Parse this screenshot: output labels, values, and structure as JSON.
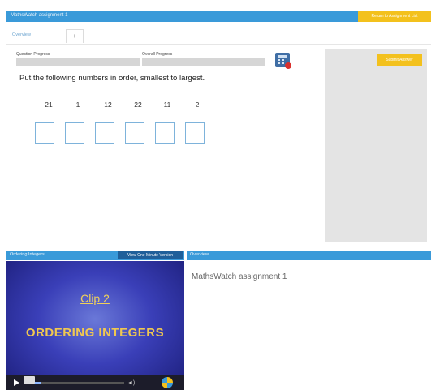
{
  "window": {
    "title": "MathsWatch assignment 1",
    "return_button": "Return to Assignment List"
  },
  "tabs": {
    "overview_label": "Overview",
    "add_label": "+"
  },
  "progress": {
    "question_label": "Question Progress",
    "question_value": 0,
    "overall_label": "Overall Progress",
    "overall_value": 0
  },
  "calculator": {
    "icon": "calculator-icon"
  },
  "question": {
    "prompt": "Put the following numbers in order, smallest to largest.",
    "numbers": [
      "21",
      "1",
      "12",
      "22",
      "11",
      "2"
    ],
    "answer_boxes": [
      "",
      "",
      "",
      "",
      "",
      ""
    ]
  },
  "actions": {
    "submit_label": "Submit Answer"
  },
  "video": {
    "panel_title": "Ordering Integers",
    "one_minute_button": "View One Minute Version",
    "clip_label": "Clip 2",
    "title": "ORDERING INTEGERS",
    "controls": {
      "progress": 0.15
    }
  },
  "overview": {
    "panel_title": "Overview",
    "text": "MathsWatch assignment 1"
  },
  "colors": {
    "header_blue": "#3a9ad9",
    "accent_yellow": "#f3c11d",
    "input_border": "#7eb3db"
  }
}
